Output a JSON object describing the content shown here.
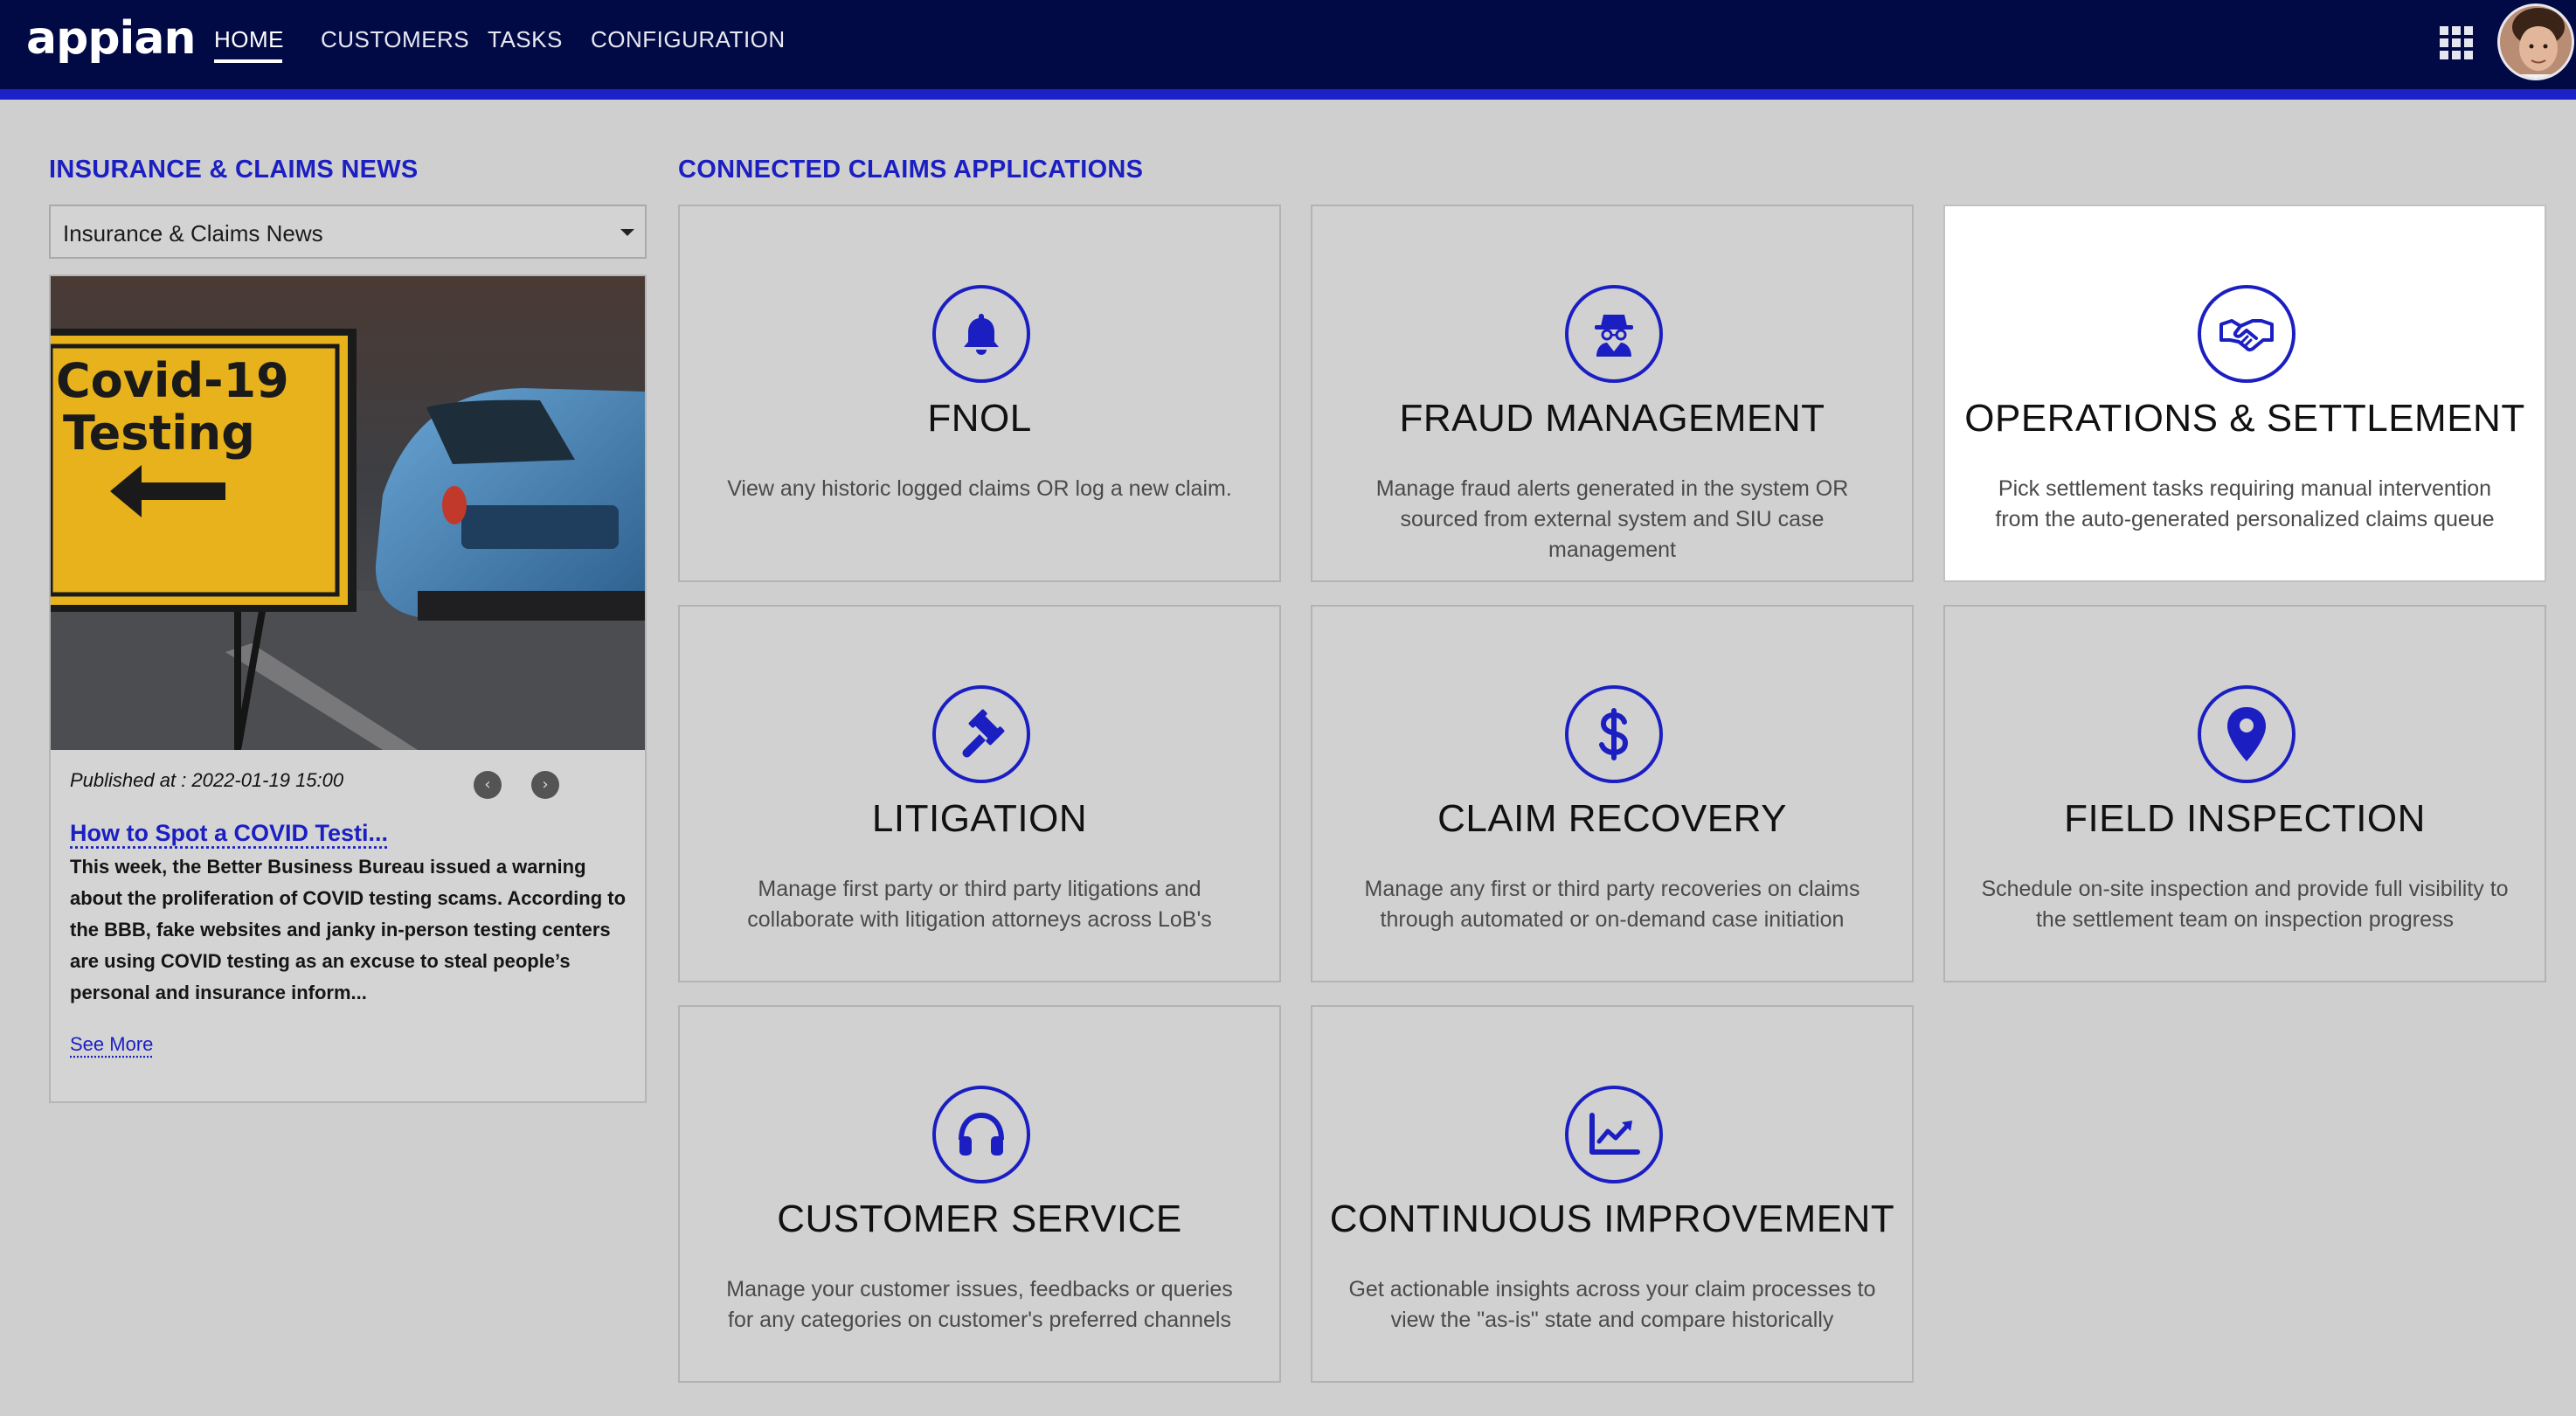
{
  "app": {
    "logo": "appian"
  },
  "nav": {
    "tabs": [
      {
        "label": "HOME",
        "active": true
      },
      {
        "label": "CUSTOMERS",
        "active": false
      },
      {
        "label": "TASKS",
        "active": false
      },
      {
        "label": "CONFIGURATION",
        "active": false
      }
    ]
  },
  "news": {
    "section_title": "INSURANCE & CLAIMS NEWS",
    "select_value": "Insurance & Claims News",
    "image_sign_text": "Covid-19 Testing",
    "published": "Published at : 2022-01-19 15:00",
    "headline": "How to Spot a COVID Testi...",
    "body": "This week, the Better Business Bureau issued a warning about the proliferation of COVID testing scams. According to the BBB, fake websites and janky in-person testing centers are using COVID testing as an excuse to steal people’s personal and insurance inform...",
    "see_more": "See More",
    "prev_glyph": "‹",
    "next_glyph": "›"
  },
  "apps": {
    "section_title": "CONNECTED CLAIMS APPLICATIONS",
    "accent_color": "#1b1fc2",
    "tiles": [
      {
        "title": "FNOL",
        "icon": "bell-icon",
        "description": "View any historic logged claims OR log a new claim."
      },
      {
        "title": "FRAUD MANAGEMENT",
        "icon": "spy-icon",
        "description": "Manage fraud alerts generated in the system OR sourced from external system and SIU case management"
      },
      {
        "title": "OPERATIONS & SETTLEMENT",
        "icon": "handshake-icon",
        "description": "Pick settlement tasks requiring manual intervention from the auto-generated personalized claims queue",
        "highlighted": true
      },
      {
        "title": "LITIGATION",
        "icon": "gavel-icon",
        "description": "Manage first party or third party litigations and collaborate with litigation attorneys across LoB's"
      },
      {
        "title": "CLAIM RECOVERY",
        "icon": "dollar-icon",
        "description": "Manage any first or third party recoveries on claims through automated or on-demand case initiation"
      },
      {
        "title": "FIELD INSPECTION",
        "icon": "map-pin-icon",
        "description": "Schedule on-site inspection and provide full visibility to the settlement team on inspection progress"
      },
      {
        "title": "CUSTOMER SERVICE",
        "icon": "headset-icon",
        "description": "Manage your customer issues, feedbacks or queries for any categories on customer's preferred channels"
      },
      {
        "title": "CONTINUOUS IMPROVEMENT",
        "icon": "chart-line-icon",
        "description": "Get actionable insights across your claim processes to view the \"as-is\" state and compare historically"
      }
    ]
  }
}
